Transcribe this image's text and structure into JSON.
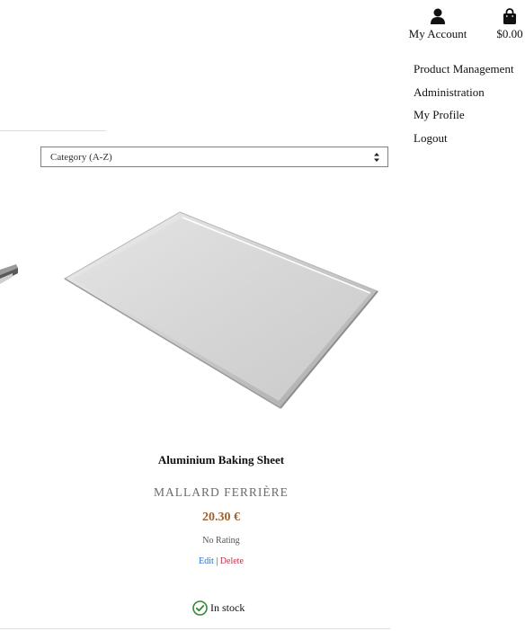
{
  "header": {
    "account_label": "My Account",
    "cart_total": "$0.00",
    "account_icon": "user-icon",
    "cart_icon": "shopping-bag-icon"
  },
  "menu": {
    "items": [
      {
        "label": "Product Management"
      },
      {
        "label": "Administration"
      },
      {
        "label": "My Profile"
      },
      {
        "label": "Logout"
      }
    ]
  },
  "sort": {
    "selected": "Category (A-Z)"
  },
  "product": {
    "name": "Aluminium Baking Sheet",
    "brand": "MALLARD FERRIÈRE",
    "price": "20.30 €",
    "rating": "No Rating",
    "edit_label": "Edit",
    "separator": "|",
    "delete_label": "Delete",
    "stock": "In stock"
  },
  "colors": {
    "accent": "#3a9cae",
    "price": "#a0602c",
    "edit": "#1e6fc6",
    "delete": "#c0304a",
    "in_stock": "#2e8b2e"
  }
}
